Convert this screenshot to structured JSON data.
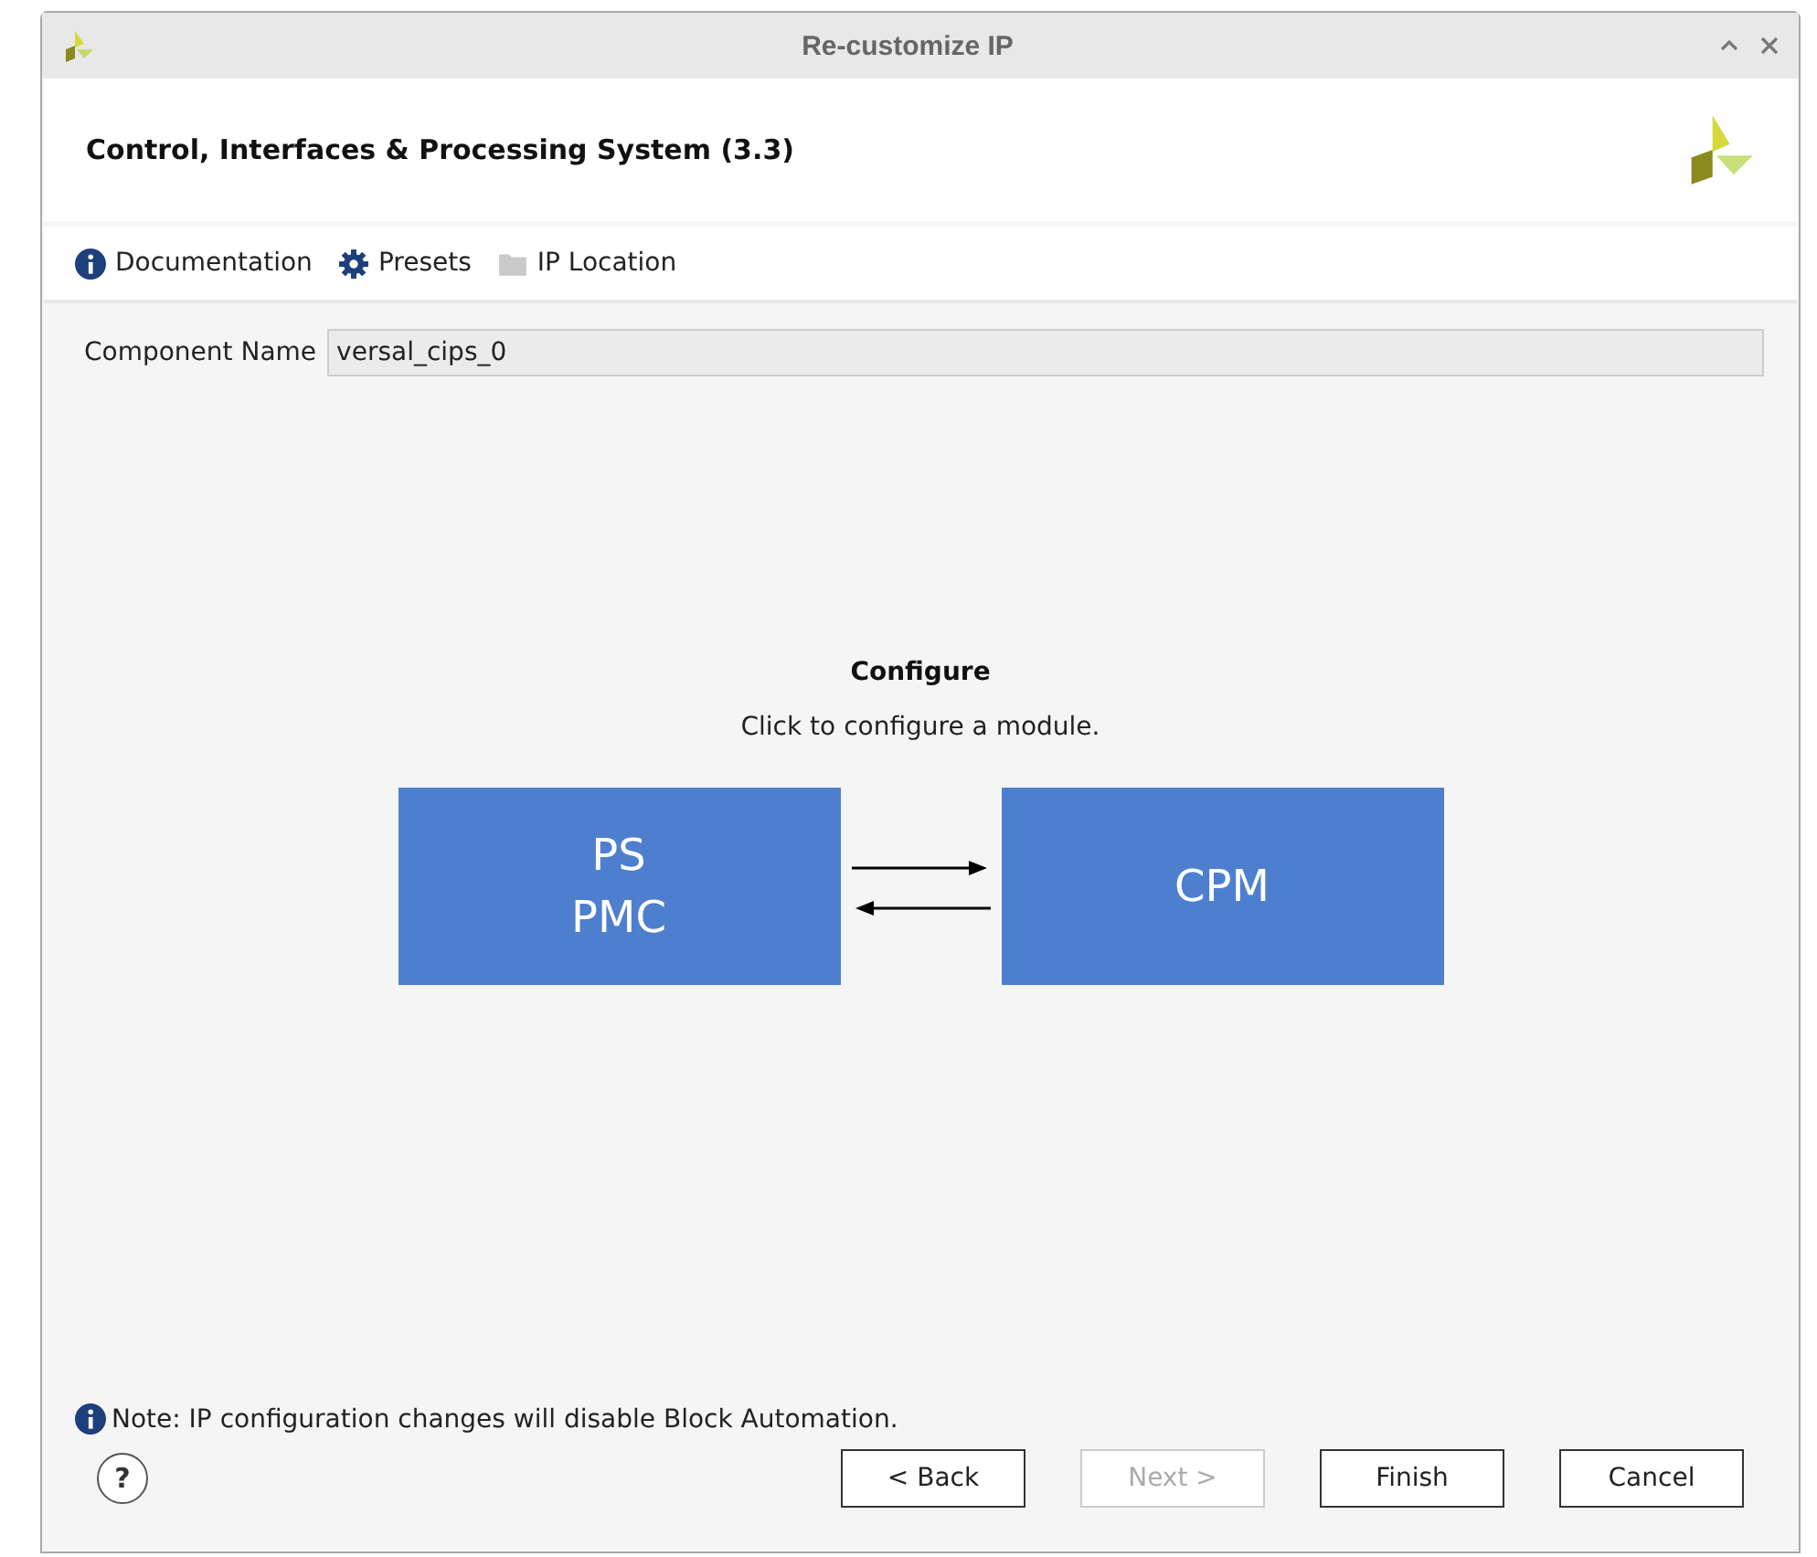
{
  "window": {
    "title": "Re-customize IP"
  },
  "header": {
    "title": "Control, Interfaces & Processing System (3.3)"
  },
  "toolbar": [
    {
      "kind": "info",
      "label": "Documentation",
      "disabled": false
    },
    {
      "kind": "gear",
      "label": "Presets",
      "disabled": false
    },
    {
      "kind": "folder",
      "label": "IP Location",
      "disabled": false
    }
  ],
  "component_name": {
    "label": "Component Name",
    "value": "versal_cips_0"
  },
  "configure": {
    "title": "Configure",
    "subtitle": "Click to configure a module.",
    "modules": [
      {
        "lines": [
          "PS",
          "PMC"
        ]
      },
      {
        "lines": [
          "CPM"
        ]
      }
    ]
  },
  "note": "Note: IP configuration changes will disable Block Automation.",
  "help_button": "?",
  "buttons": [
    {
      "label": "< Back",
      "disabled": false
    },
    {
      "label": "Next >",
      "disabled": true
    },
    {
      "label": "Finish",
      "disabled": false
    },
    {
      "label": "Cancel",
      "disabled": false
    }
  ]
}
